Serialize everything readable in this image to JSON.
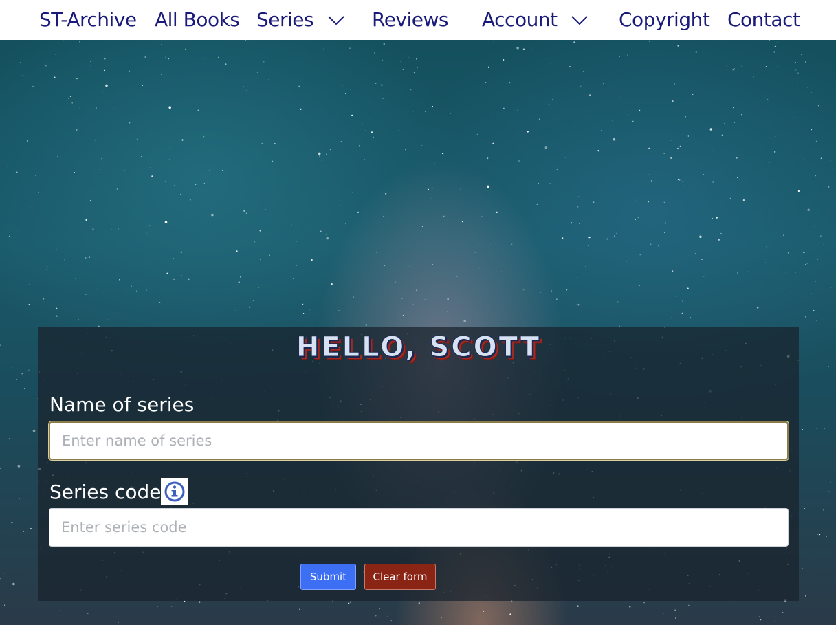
{
  "nav": {
    "items": [
      {
        "label": "ST-Archive",
        "dropdown": false
      },
      {
        "label": "All Books",
        "dropdown": false
      },
      {
        "label": "Series",
        "dropdown": true
      },
      {
        "label": "Reviews",
        "dropdown": false
      },
      {
        "label": "Account",
        "dropdown": true
      },
      {
        "label": "Copyright",
        "dropdown": false
      },
      {
        "label": "Contact",
        "dropdown": false
      }
    ]
  },
  "form": {
    "greeting": "HELLO, SCOTT",
    "name_label": "Name of series",
    "name_placeholder": "Enter name of series",
    "name_value": "",
    "code_label": "Series code",
    "code_placeholder": "Enter series code",
    "code_value": "",
    "info_icon": "info-circle-icon",
    "submit_label": "Submit",
    "clear_label": "Clear form"
  },
  "colors": {
    "nav_text": "#1a1a7a",
    "submit": "#3d6ff5",
    "clear": "#8a2414",
    "info_icon": "#3f5fbf"
  }
}
